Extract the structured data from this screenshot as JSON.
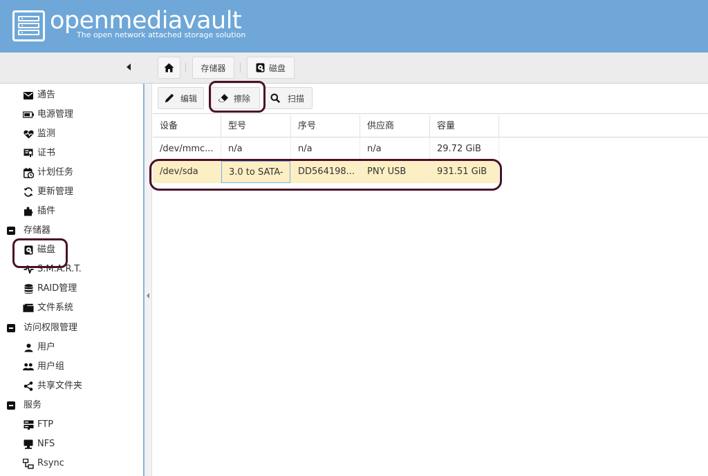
{
  "header": {
    "title": "openmediavault",
    "subtitle": "The open network attached storage solution"
  },
  "breadcrumb": {
    "home_icon": "home-icon",
    "items": [
      {
        "label": "存储器"
      },
      {
        "label": "磁盘",
        "icon": "disk-icon"
      }
    ]
  },
  "sidebar": {
    "items": [
      {
        "label": "通告",
        "icon": "envelope-icon"
      },
      {
        "label": "电源管理",
        "icon": "battery-icon"
      },
      {
        "label": "监测",
        "icon": "heartbeat-icon"
      },
      {
        "label": "证书",
        "icon": "certificate-icon"
      },
      {
        "label": "计划任务",
        "icon": "calendar-clock-icon"
      },
      {
        "label": "更新管理",
        "icon": "refresh-icon"
      },
      {
        "label": "插件",
        "icon": "puzzle-icon"
      }
    ],
    "groups": [
      {
        "label": "存储器",
        "items": [
          {
            "label": "磁盘",
            "icon": "disk-icon"
          },
          {
            "label": "S.M.A.R.T.",
            "icon": "pulse-icon"
          },
          {
            "label": "RAID管理",
            "icon": "database-icon"
          },
          {
            "label": "文件系统",
            "icon": "folder-icon"
          }
        ]
      },
      {
        "label": "访问权限管理",
        "items": [
          {
            "label": "用户",
            "icon": "user-icon"
          },
          {
            "label": "用户组",
            "icon": "users-icon"
          },
          {
            "label": "共享文件夹",
            "icon": "share-icon"
          }
        ]
      },
      {
        "label": "服务",
        "items": [
          {
            "label": "FTP",
            "icon": "server-icon"
          },
          {
            "label": "NFS",
            "icon": "desktop-icon"
          },
          {
            "label": "Rsync",
            "icon": "sitemap-icon"
          }
        ]
      }
    ]
  },
  "toolbar": {
    "edit_label": "编辑",
    "wipe_label": "擦除",
    "scan_label": "扫描"
  },
  "table": {
    "columns": [
      "设备",
      "型号",
      "序号",
      "供应商",
      "容量"
    ],
    "rows": [
      [
        "/dev/mmc...",
        "n/a",
        "n/a",
        "n/a",
        "29.72 GiB"
      ],
      [
        "/dev/sda",
        "3.0 to SATA-",
        "DD564198...",
        "PNY USB",
        "931.51 GiB"
      ]
    ],
    "selected_row": 1
  },
  "colors": {
    "header_bg": "#6ea7d8",
    "selected_row": "#fdefc4",
    "annotation": "#4a1028"
  }
}
